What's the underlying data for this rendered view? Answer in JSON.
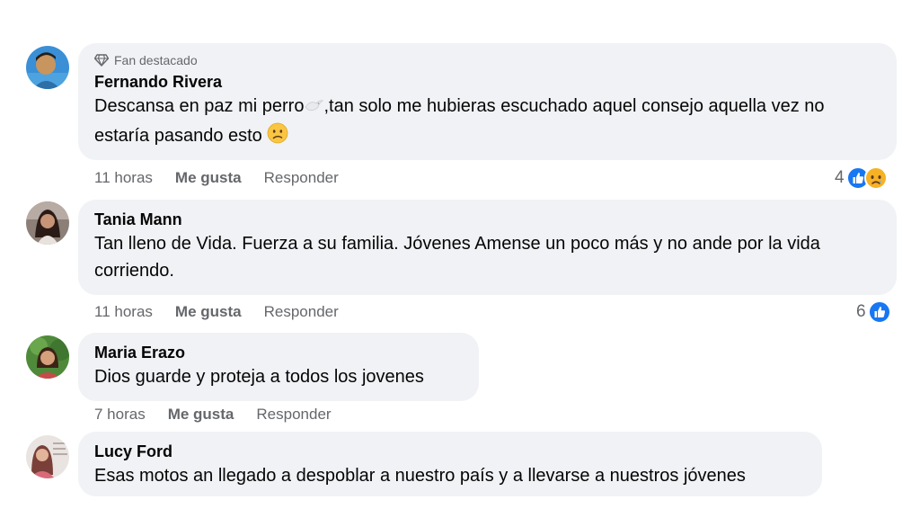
{
  "comments": [
    {
      "badge": "Fan destacado",
      "author": "Fernando Rivera",
      "text_part1": "Descansa en paz mi perro",
      "text_part2": ",tan solo me hubieras escuchado aquel consejo aquella vez no estaría pasando esto",
      "time": "11 horas",
      "like": "Me gusta",
      "reply": "Responder",
      "reaction_count": "4",
      "reactions": [
        "like-icon",
        "sad-icon"
      ]
    },
    {
      "author": "Tania Mann",
      "text": "Tan lleno de Vida. Fuerza a su familia. Jóvenes Amense un poco más y no ande por la vida corriendo.",
      "time": "11 horas",
      "like": "Me gusta",
      "reply": "Responder",
      "reaction_count": "6",
      "reactions": [
        "like-icon"
      ]
    },
    {
      "author": "Maria Erazo",
      "text": "Dios guarde y proteja a todos los jovenes",
      "time": "7 horas",
      "like": "Me gusta",
      "reply": "Responder"
    },
    {
      "author": "Lucy Ford",
      "text": "Esas motos an llegado a despoblar a nuestro país y a llevarse a nuestros jóvenes"
    }
  ],
  "colors": {
    "bubble": "#f0f2f5",
    "secondary_text": "#65676b",
    "like_blue": "#1877f2",
    "sad_yellow": "#f7b125"
  }
}
